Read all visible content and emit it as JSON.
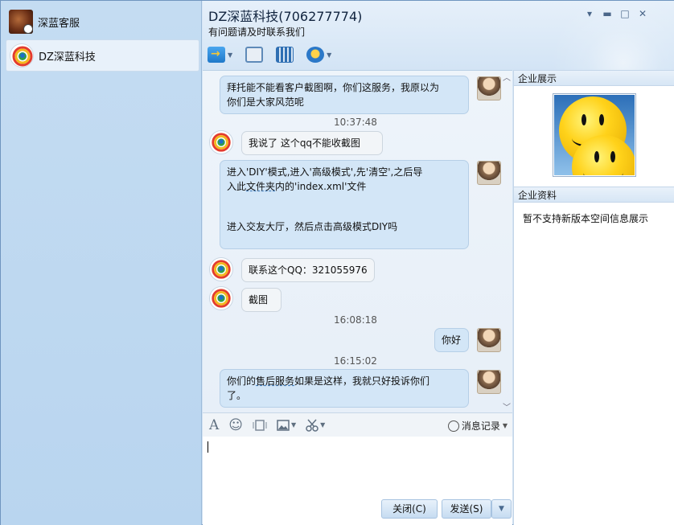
{
  "sidebar": {
    "contacts": [
      {
        "name": "深蓝客服"
      },
      {
        "name": "DZ深蓝科技"
      }
    ]
  },
  "header": {
    "title": "DZ深蓝科技(706277774)",
    "subtitle": "有问题请及时联系我们"
  },
  "window_controls": {
    "menu": "▾",
    "minimize": "▬",
    "maximize": "□",
    "close": "✕"
  },
  "messages": [
    {
      "side": "right",
      "lines": [
        "拜托能不能看客户截图啊，你们这服务，我原以为",
        "你们是大家风范呢"
      ]
    },
    {
      "time": "10:37:48"
    },
    {
      "side": "left",
      "lines": [
        "我说了 这个qq不能收截图"
      ]
    },
    {
      "side": "right",
      "lines": [
        "进入'DIY'模式,进入'高级模式',先'清空',之后导",
        "入此",
        "文件夹",
        "内的'index.xml'文件",
        "进入交友大厅，然后点击高级模式DIY吗"
      ]
    },
    {
      "side": "left",
      "lines": [
        "联系这个QQ：321055976"
      ]
    },
    {
      "side": "left",
      "lines": [
        "截图"
      ]
    },
    {
      "time": "16:08:18"
    },
    {
      "side": "right",
      "lines": [
        "你好"
      ]
    },
    {
      "time": "16:15:02"
    },
    {
      "side": "right",
      "lines": [
        "你们的",
        "售后服务",
        "如果是这样，我就只好投诉你们",
        "了。"
      ]
    }
  ],
  "input_toolbar": {
    "font": "A",
    "emoji": "☺",
    "message_record": "消息记录"
  },
  "buttons": {
    "close": "关闭(C)",
    "send": "发送(S)",
    "send_options": "▼"
  },
  "right_panel": {
    "showcase_title": "企业展示",
    "info_title": "企业资料",
    "info_text": "暂不支持新版本空间信息展示"
  }
}
